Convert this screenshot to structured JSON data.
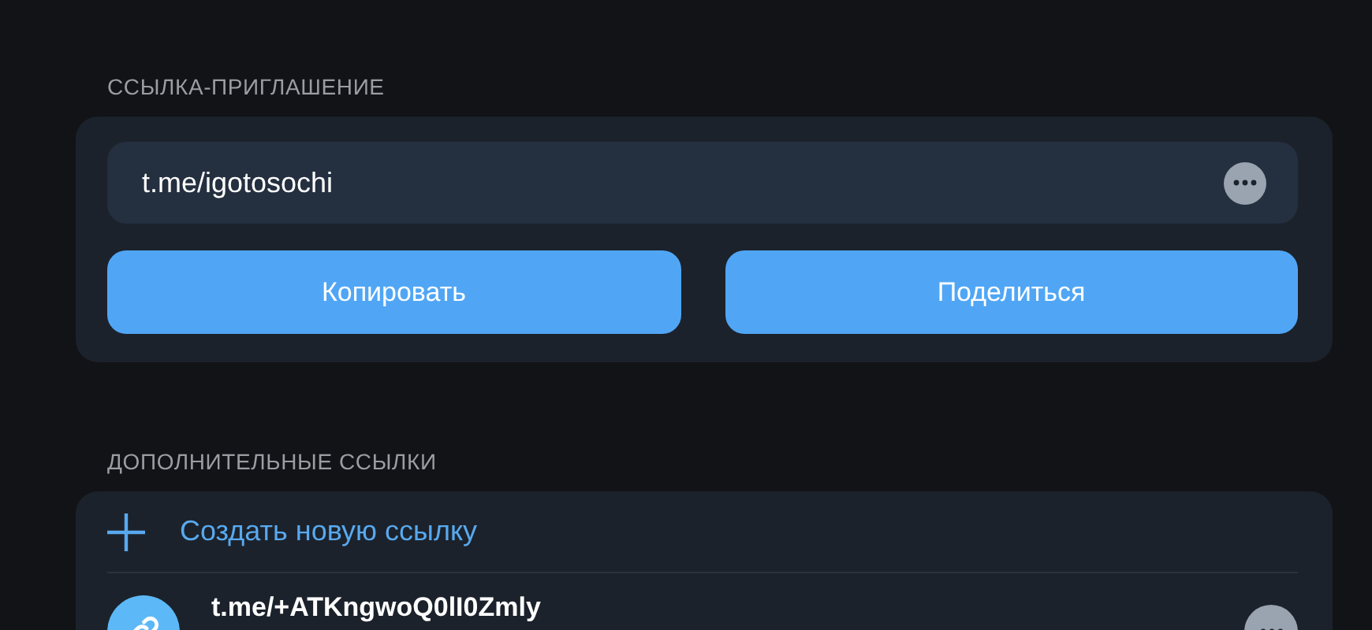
{
  "invite_section": {
    "header": "ССЫЛКА-ПРИГЛАШЕНИЕ",
    "link": "t.me/igotosochi",
    "buttons": [
      "Копировать",
      "Поделиться"
    ]
  },
  "extra_section": {
    "header": "ДОПОЛНИТЕЛЬНЫЕ ССЫЛКИ",
    "create_label": "Создать новую ссылку",
    "links": [
      {
        "url": "t.me/+ATKngwoQ0lI0Zmly"
      }
    ]
  }
}
